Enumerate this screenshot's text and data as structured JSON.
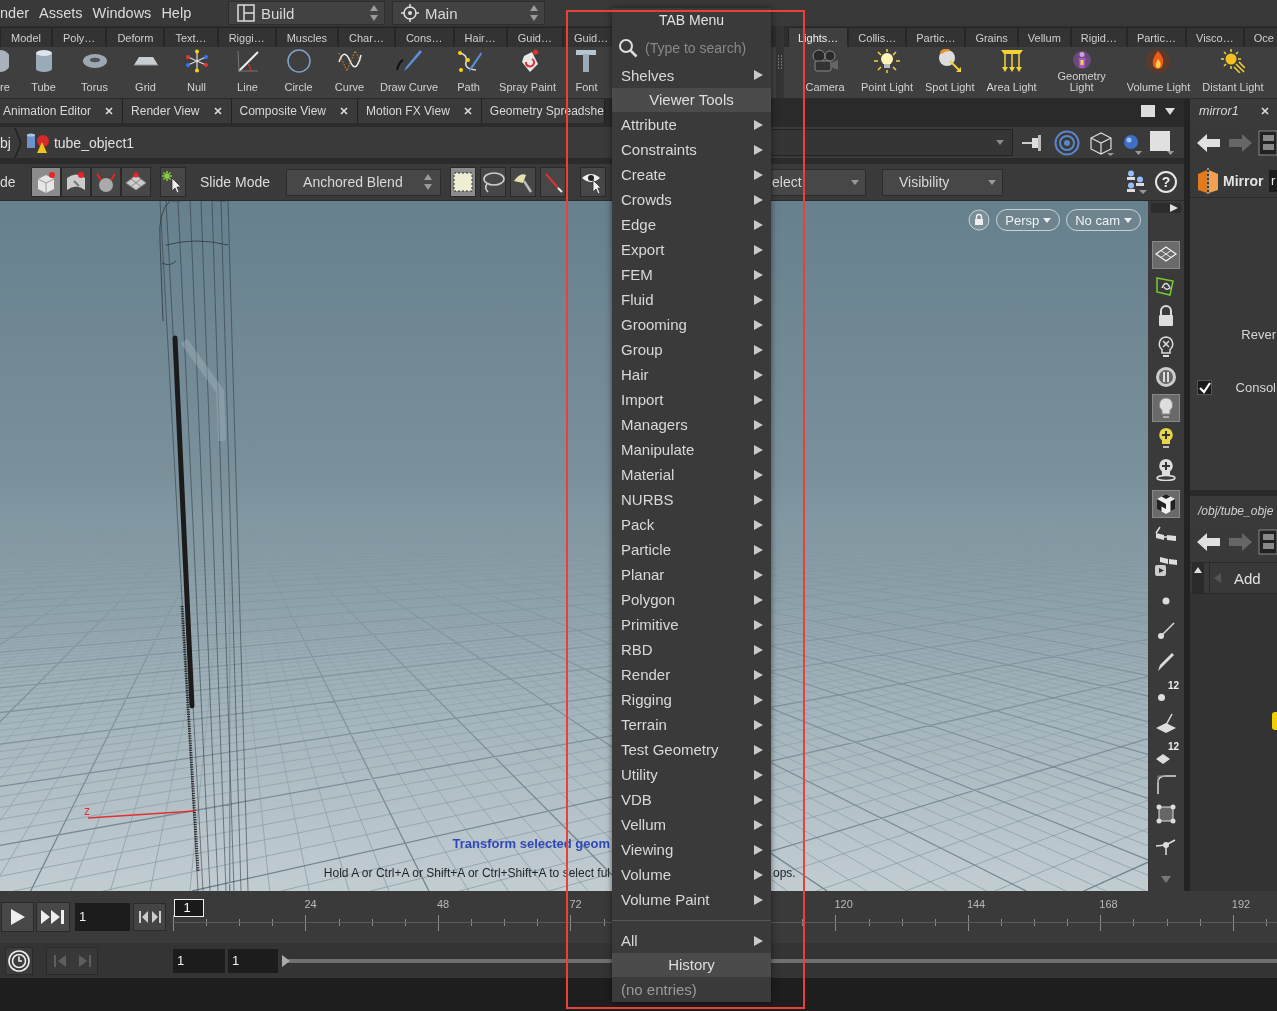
{
  "menu_bar": {
    "items": [
      "nder",
      "Assets",
      "Windows",
      "Help"
    ],
    "desktop": "Build",
    "context": "Main"
  },
  "shelves": [
    {
      "tabs": [
        {
          "label": "Model",
          "selected": false
        },
        {
          "label": "Poly…",
          "selected": false
        },
        {
          "label": "Deform",
          "selected": false
        },
        {
          "label": "Text…",
          "selected": false
        },
        {
          "label": "Riggi…",
          "selected": false
        },
        {
          "label": "Muscles",
          "selected": false
        },
        {
          "label": "Char…",
          "selected": false
        },
        {
          "label": "Cons…",
          "selected": false
        },
        {
          "label": "Hair…",
          "selected": false
        },
        {
          "label": "Guid…",
          "selected": false
        },
        {
          "label": "Guid…",
          "selected": false
        }
      ],
      "tools": [
        "re",
        "Tube",
        "Torus",
        "Grid",
        "Null",
        "Line",
        "Circle",
        "Curve",
        "Draw Curve",
        "Path",
        "Spray Paint",
        "Font"
      ]
    },
    {
      "tabs": [
        {
          "label": "Lights…",
          "selected": true
        },
        {
          "label": "Collis…",
          "selected": false
        },
        {
          "label": "Partic…",
          "selected": false
        },
        {
          "label": "Grains",
          "selected": false
        },
        {
          "label": "Vellum",
          "selected": false
        },
        {
          "label": "Rigid…",
          "selected": false
        },
        {
          "label": "Partic…",
          "selected": false
        },
        {
          "label": "Visco…",
          "selected": false
        },
        {
          "label": "Oce",
          "selected": false
        }
      ],
      "tools": [
        "Camera",
        "Point Light",
        "Spot Light",
        "Area Light",
        "Geometry Light",
        "Volume Light",
        "Distant Light"
      ]
    }
  ],
  "pane_tabs": [
    {
      "label": "Animation Editor",
      "selected": false,
      "closable": true
    },
    {
      "label": "Render View",
      "selected": false,
      "closable": true
    },
    {
      "label": "Composite View",
      "selected": false,
      "closable": true
    },
    {
      "label": "Motion FX View",
      "selected": false,
      "closable": true
    },
    {
      "label": "Geometry Spreadshe",
      "selected": false,
      "closable": false
    }
  ],
  "path_bar": {
    "crumbs": [
      "bj",
      "tube_object1"
    ]
  },
  "viewer_toolbar": {
    "mode_label": "de",
    "modes": [
      {
        "selected": true
      },
      {
        "selected": false
      },
      {
        "selected": false
      },
      {
        "selected": false
      }
    ],
    "slide_mode_label": "Slide Mode",
    "slide_mode": "Anchored Blend",
    "select_styles": [
      {
        "selected": true
      },
      {
        "selected": false
      },
      {
        "selected": false
      },
      {
        "selected": false
      }
    ],
    "select_menu": "elect",
    "visibility_menu": "Visibility",
    "help": "?"
  },
  "viewport": {
    "view_menu": "Persp",
    "camera_menu": "No cam",
    "axis_label": "z",
    "hint_title": "Transform selected geom",
    "hint_text": "Hold A or Ctrl+A or Shift+A or Ctrl+Shift+A to select ful",
    "hint_text_right": "ops."
  },
  "display_toolbar": [
    {
      "on": true
    },
    {
      "on": false
    },
    {
      "on": false
    },
    {
      "on": false
    },
    {
      "on": false
    },
    {
      "on": true
    },
    {
      "on": false
    },
    {
      "on": false
    },
    {
      "on": true
    },
    {
      "on": false
    },
    {
      "on": false
    },
    {
      "on": false
    },
    {
      "on": false
    },
    {
      "on": false
    },
    {
      "on": false,
      "badge": "12"
    },
    {
      "on": false
    },
    {
      "on": false,
      "badge": "12"
    },
    {
      "on": false
    },
    {
      "on": false
    },
    {
      "on": false
    }
  ],
  "parameter_pane": {
    "tab": "mirror1",
    "node_type": "Mirror",
    "name": "r",
    "parameters": [
      {
        "kind": "label",
        "label": "Rever"
      },
      {
        "kind": "checkbox",
        "label": "Consol",
        "checked": true
      }
    ]
  },
  "network_pane": {
    "path": "/obj/tube_obje",
    "add_button": "Add"
  },
  "timeline": {
    "frame": "1",
    "frame_field": "1",
    "ticks": [
      "24",
      "48",
      "72",
      "120",
      "144",
      "168",
      "192"
    ],
    "start": "1",
    "end": "1",
    "jump_buttons": {
      "disabled": true
    }
  },
  "tab_menu": {
    "title": "TAB Menu",
    "search": {
      "placeholder": "(Type to search)"
    },
    "items": [
      {
        "kind": "item",
        "label": "Shelves",
        "submenu": true
      },
      {
        "kind": "header",
        "label": "Viewer Tools"
      },
      {
        "kind": "item",
        "label": "Attribute",
        "submenu": true
      },
      {
        "kind": "item",
        "label": "Constraints",
        "submenu": true
      },
      {
        "kind": "item",
        "label": "Create",
        "submenu": true
      },
      {
        "kind": "item",
        "label": "Crowds",
        "submenu": true
      },
      {
        "kind": "item",
        "label": "Edge",
        "submenu": true
      },
      {
        "kind": "item",
        "label": "Export",
        "submenu": true
      },
      {
        "kind": "item",
        "label": "FEM",
        "submenu": true
      },
      {
        "kind": "item",
        "label": "Fluid",
        "submenu": true
      },
      {
        "kind": "item",
        "label": "Grooming",
        "submenu": true
      },
      {
        "kind": "item",
        "label": "Group",
        "submenu": true
      },
      {
        "kind": "item",
        "label": "Hair",
        "submenu": true
      },
      {
        "kind": "item",
        "label": "Import",
        "submenu": true
      },
      {
        "kind": "item",
        "label": "Managers",
        "submenu": true
      },
      {
        "kind": "item",
        "label": "Manipulate",
        "submenu": true
      },
      {
        "kind": "item",
        "label": "Material",
        "submenu": true
      },
      {
        "kind": "item",
        "label": "NURBS",
        "submenu": true
      },
      {
        "kind": "item",
        "label": "Pack",
        "submenu": true
      },
      {
        "kind": "item",
        "label": "Particle",
        "submenu": true
      },
      {
        "kind": "item",
        "label": "Planar",
        "submenu": true
      },
      {
        "kind": "item",
        "label": "Polygon",
        "submenu": true
      },
      {
        "kind": "item",
        "label": "Primitive",
        "submenu": true
      },
      {
        "kind": "item",
        "label": "RBD",
        "submenu": true
      },
      {
        "kind": "item",
        "label": "Render",
        "submenu": true
      },
      {
        "kind": "item",
        "label": "Rigging",
        "submenu": true
      },
      {
        "kind": "item",
        "label": "Terrain",
        "submenu": true
      },
      {
        "kind": "item",
        "label": "Test Geometry",
        "submenu": true
      },
      {
        "kind": "item",
        "label": "Utility",
        "submenu": true
      },
      {
        "kind": "item",
        "label": "VDB",
        "submenu": true
      },
      {
        "kind": "item",
        "label": "Vellum",
        "submenu": true
      },
      {
        "kind": "item",
        "label": "Viewing",
        "submenu": true
      },
      {
        "kind": "item",
        "label": "Volume",
        "submenu": true
      },
      {
        "kind": "item",
        "label": "Volume Paint",
        "submenu": true
      },
      {
        "kind": "separator"
      },
      {
        "kind": "item",
        "label": "All",
        "submenu": true
      },
      {
        "kind": "header",
        "label": "History"
      },
      {
        "kind": "note",
        "label": "(no entries)"
      }
    ]
  },
  "highlight_frame": true
}
